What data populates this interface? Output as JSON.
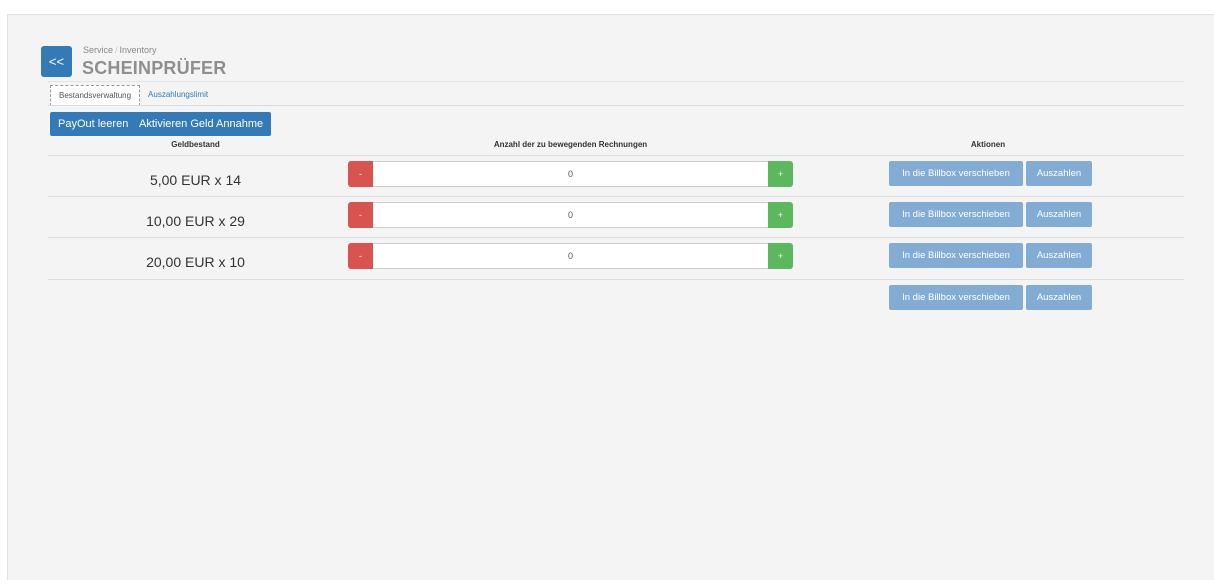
{
  "header": {
    "back_label": "<<",
    "breadcrumb": [
      "Service",
      "Inventory"
    ],
    "breadcrumb_separator": "/",
    "title": "SCHEINPRÜFER"
  },
  "tabs": [
    {
      "label": "Bestandsverwaltung",
      "active": true
    },
    {
      "label": "Auszahlungslimit",
      "active": false
    }
  ],
  "toolbar": {
    "payout_clear_label": "PayOut leeren",
    "activate_label": "Aktivieren Geld Annahme"
  },
  "table": {
    "columns": [
      "Geldbestand",
      "Anzahl der zu bewegenden Rechnungen",
      "Aktionen"
    ],
    "rows": [
      {
        "amount": "5,00 EUR x 14",
        "count": "0"
      },
      {
        "amount": "10,00 EUR x 29",
        "count": "0"
      },
      {
        "amount": "20,00 EUR x 10",
        "count": "0"
      }
    ],
    "minus_label": "-",
    "plus_label": "+",
    "billbox_label": "In die Billbox verschieben",
    "payout_label": "Auszahlen"
  },
  "colors": {
    "primary": "#337ab7",
    "primary_light": "#83acd5",
    "danger": "#d9534f",
    "success": "#5cb85c"
  }
}
